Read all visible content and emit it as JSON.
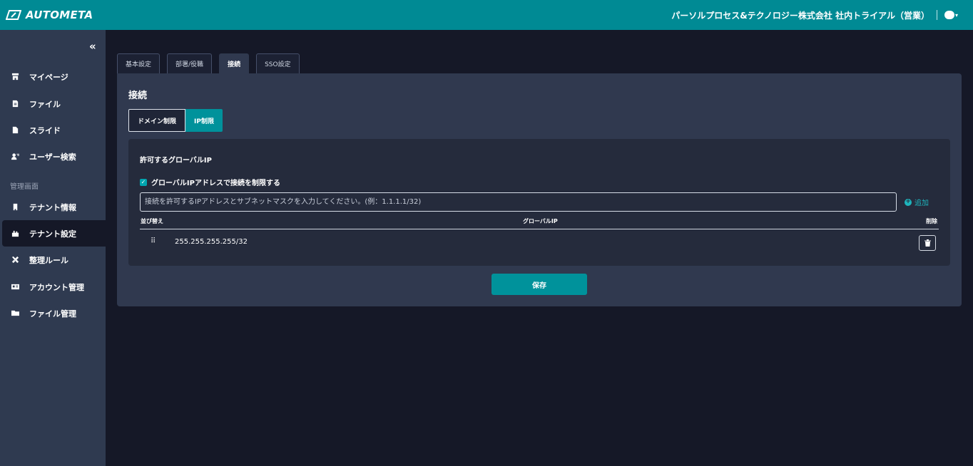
{
  "header": {
    "brand": "AUTOMETA",
    "org_user": "パーソルプロセス&テクノロジー株式会社 社内トライアル（営業）"
  },
  "sidebar": {
    "items": [
      {
        "label": "マイページ",
        "icon": "store-icon"
      },
      {
        "label": "ファイル",
        "icon": "file-icon"
      },
      {
        "label": "スライド",
        "icon": "document-icon"
      },
      {
        "label": "ユーザー検索",
        "icon": "user-search-icon"
      }
    ],
    "admin_section_label": "管理画面",
    "admin_items": [
      {
        "label": "テナント情報",
        "icon": "building-icon"
      },
      {
        "label": "テナント設定",
        "icon": "tenant-settings-icon",
        "active": true
      },
      {
        "label": "整理ルール",
        "icon": "tools-icon"
      },
      {
        "label": "アカウント管理",
        "icon": "id-card-icon"
      },
      {
        "label": "ファイル管理",
        "icon": "folder-icon"
      }
    ]
  },
  "tabs": [
    "基本設定",
    "部署/役職",
    "接続",
    "SSO設定"
  ],
  "active_tab": "接続",
  "panel": {
    "title": "接続",
    "subtabs": [
      "ドメイン制限",
      "IP制限"
    ],
    "active_subtab": "IP制限",
    "card_title": "許可するグローバルIP",
    "checkbox_label": "グローバルIPアドレスで接続を制限する",
    "checkbox_checked": true,
    "input_placeholder": "接続を許可するIPアドレスとサブネットマスクを入力してください。(例：1.1.1.1/32)",
    "add_label": "追加",
    "table": {
      "headers": {
        "sort": "並び替え",
        "ip": "グローバルIP",
        "delete": "削除"
      },
      "rows": [
        {
          "ip": "255.255.255.255/32"
        }
      ]
    },
    "save_label": "保存"
  },
  "colors": {
    "accent": "#008a94",
    "sidebar_bg": "#2f3a50",
    "panel_bg": "#30394f",
    "page_bg": "#151827"
  }
}
